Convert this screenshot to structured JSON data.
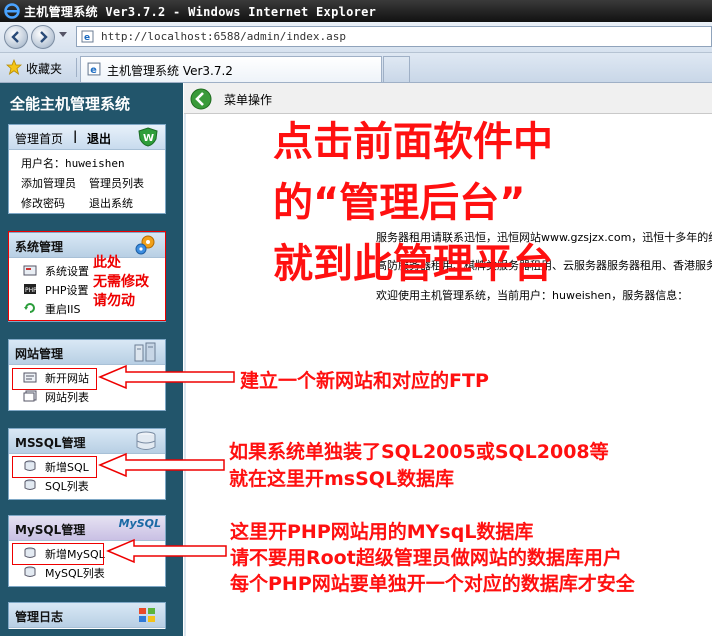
{
  "window": {
    "title": "主机管理系统 Ver3.7.2 - Windows Internet Explorer"
  },
  "address_bar": {
    "url": "http://localhost:6588/admin/index.asp"
  },
  "tabs": {
    "favorites_label": "收藏夹",
    "active_tab_label": "主机管理系统 Ver3.7.2"
  },
  "sidebar": {
    "title": "全能主机管理系统",
    "admin_panel": {
      "home_label": "管理首页",
      "separator": "|",
      "exit_label": "退出",
      "username_label": "用户名：",
      "username_value": "huweishen",
      "add_admin": "添加管理员",
      "admin_list": "管理员列表",
      "change_password": "修改密码",
      "logout": "退出系统"
    },
    "system_panel": {
      "title": "系统管理",
      "items": [
        "系统设置",
        "PHP设置",
        "重启IIS"
      ]
    },
    "site_panel": {
      "title": "网站管理",
      "items": [
        "新开网站",
        "网站列表"
      ]
    },
    "mssql_panel": {
      "title": "MSSQL管理",
      "items": [
        "新增SQL",
        "SQL列表"
      ]
    },
    "mysql_panel": {
      "title": "MySQL管理",
      "logo_text": "MySQL",
      "items": [
        "新增MySQL",
        "MySQL列表"
      ]
    },
    "log_panel": {
      "title": "管理日志"
    }
  },
  "content": {
    "header_label": "菜单操作",
    "info_lines": [
      "服务器租用请联系迅恒，迅恒网站www.gzsjzx.com，迅恒十多年的经验",
      "高防服务器租用、棋牌类服务器租用、云服务器服务器租用、香港服务器",
      "欢迎使用主机管理系统，当前用户：huweishen，服务器信息："
    ]
  },
  "annotations": {
    "big_note_lines": [
      "点击前面软件中",
      "的“管理后台”",
      "就到此管理平台"
    ],
    "system_note_lines": [
      "此处",
      "无需修改",
      "请勿动"
    ],
    "site_note": "建立一个新网站和对应的FTP",
    "mssql_note_lines": [
      "如果系统单独装了SQL2005或SQL2008等",
      "就在这里开msSQL数据库"
    ],
    "mysql_note_lines": [
      "这里开PHP网站用的MYsqL数据库",
      "请不要用Root超级管理员做网站的数据库用户",
      "每个PHP网站要单独开一个对应的数据库才安全"
    ]
  },
  "colors": {
    "annotation_red": "#ff1010",
    "sidebar_bg": "#22556b"
  }
}
